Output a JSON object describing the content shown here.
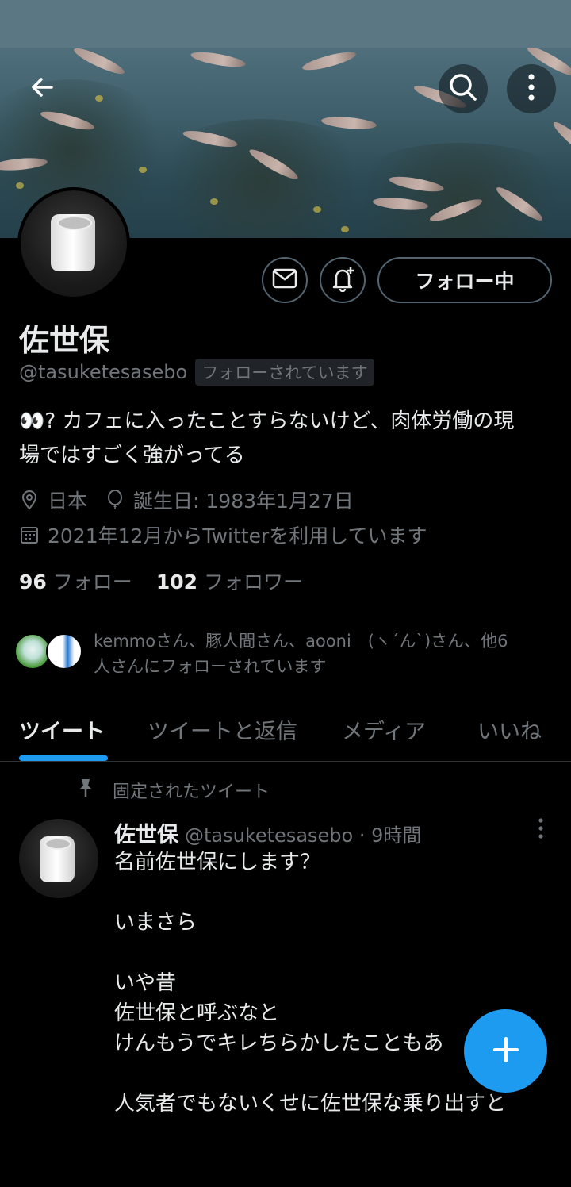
{
  "profile": {
    "name": "佐世保",
    "handle": "@tasuketesasebo",
    "follows_you": "フォローされています",
    "bio_line1": "👀? カフェに入ったことすらないけど、肉体労働の現",
    "bio_line2": "場ではすごく強がってる",
    "location": "日本",
    "birthday": "誕生日: 1983年1月27日",
    "joined": "2021年12月からTwitterを利用しています",
    "following_count": "96",
    "following_label": "フォロー",
    "followers_count": "102",
    "followers_label": "フォロワー",
    "follow_button": "フォロー中",
    "mutual_line1": "kemmoさん、豚人間さん、aooni　(ヽ´ん`)さん、他6",
    "mutual_line2": "人さんにフォローされています"
  },
  "tabs": [
    {
      "label": "ツイート",
      "active": true
    },
    {
      "label": "ツイートと返信",
      "active": false
    },
    {
      "label": "メディア",
      "active": false
    },
    {
      "label": "いいね",
      "active": false
    }
  ],
  "pinned": {
    "label": "固定されたツイート",
    "author": "佐世保",
    "handle_time": "@tasuketesasebo · 9時間",
    "body": "名前佐世保にします？\n\nいまさら\n\nいや昔\n佐世保と呼ぶなと\nけんもうでキレちらかしたこともあ\n\n人気者でもないくせに佐世保な乗り出すと"
  },
  "icons": {
    "back": "arrow-left-icon",
    "search": "search-icon",
    "more": "more-vertical-icon",
    "message": "envelope-icon",
    "notify": "bell-plus-icon",
    "location": "location-pin-icon",
    "birthday": "balloon-icon",
    "calendar": "calendar-icon",
    "pin": "pin-icon",
    "compose": "plus-icon"
  },
  "colors": {
    "accent": "#1d9bf0",
    "background": "#000000",
    "secondary_text": "#71767b"
  }
}
